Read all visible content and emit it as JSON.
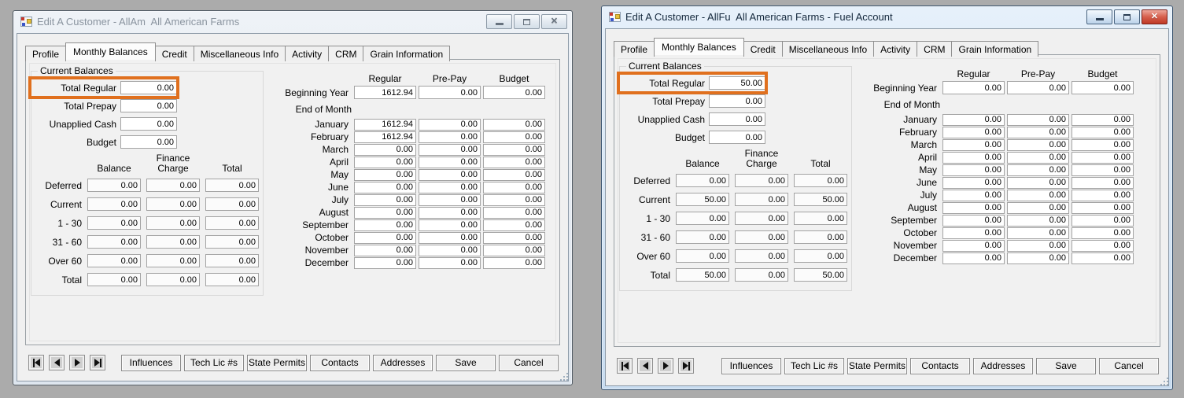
{
  "colors": {
    "highlight_border": "#e0701e",
    "active_titlebar": "#c8dcf0",
    "inactive_titlebar": "#dde5ee",
    "close_button_red": "#bf3a27",
    "desktop_background": "#ababab"
  },
  "app": {
    "tabs": [
      "Profile",
      "Monthly Balances",
      "Credit",
      "Miscellaneous Info",
      "Activity",
      "CRM",
      "Grain Information"
    ],
    "active_tab": "Monthly Balances",
    "nav_icons": [
      "nav-first",
      "nav-previous",
      "nav-next",
      "nav-last"
    ],
    "caption_icons": [
      "minimize",
      "maximize",
      "close"
    ],
    "footer_buttons": [
      "Influences",
      "Tech Lic #s",
      "State Permits",
      "Contacts",
      "Addresses",
      "Save",
      "Cancel"
    ]
  },
  "windows": [
    {
      "title": "Edit A Customer - AllAm  All American Farms",
      "state": "inactive",
      "highlighted_field": "Total Regular",
      "current_balances": {
        "title": "Current Balances",
        "rows": [
          {
            "label": "Total Regular",
            "value": "0.00",
            "highlighted": true
          },
          {
            "label": "Total Prepay",
            "value": "0.00"
          },
          {
            "label": "Unapplied Cash",
            "value": "0.00"
          },
          {
            "label": "Budget",
            "value": "0.00"
          }
        ]
      },
      "aging": {
        "columns": [
          "Balance",
          "Finance Charge",
          "Total"
        ],
        "rows": [
          {
            "label": "Deferred",
            "balance": "0.00",
            "finance_charge": "0.00",
            "total": "0.00"
          },
          {
            "label": "Current",
            "balance": "0.00",
            "finance_charge": "0.00",
            "total": "0.00"
          },
          {
            "label": "1 - 30",
            "balance": "0.00",
            "finance_charge": "0.00",
            "total": "0.00"
          },
          {
            "label": "31 - 60",
            "balance": "0.00",
            "finance_charge": "0.00",
            "total": "0.00"
          },
          {
            "label": "Over 60",
            "balance": "0.00",
            "finance_charge": "0.00",
            "total": "0.00"
          },
          {
            "label": "Total",
            "balance": "0.00",
            "finance_charge": "0.00",
            "total": "0.00"
          }
        ]
      },
      "monthly": {
        "columns": [
          "Regular",
          "Pre-Pay",
          "Budget"
        ],
        "beginning_year": {
          "label": "Beginning Year",
          "regular": "1612.94",
          "prepay": "0.00",
          "budget": "0.00"
        },
        "end_of_month_label": "End of Month",
        "months": [
          {
            "label": "January",
            "regular": "1612.94",
            "prepay": "0.00",
            "budget": "0.00"
          },
          {
            "label": "February",
            "regular": "1612.94",
            "prepay": "0.00",
            "budget": "0.00"
          },
          {
            "label": "March",
            "regular": "0.00",
            "prepay": "0.00",
            "budget": "0.00"
          },
          {
            "label": "April",
            "regular": "0.00",
            "prepay": "0.00",
            "budget": "0.00"
          },
          {
            "label": "May",
            "regular": "0.00",
            "prepay": "0.00",
            "budget": "0.00"
          },
          {
            "label": "June",
            "regular": "0.00",
            "prepay": "0.00",
            "budget": "0.00"
          },
          {
            "label": "July",
            "regular": "0.00",
            "prepay": "0.00",
            "budget": "0.00"
          },
          {
            "label": "August",
            "regular": "0.00",
            "prepay": "0.00",
            "budget": "0.00"
          },
          {
            "label": "September",
            "regular": "0.00",
            "prepay": "0.00",
            "budget": "0.00"
          },
          {
            "label": "October",
            "regular": "0.00",
            "prepay": "0.00",
            "budget": "0.00"
          },
          {
            "label": "November",
            "regular": "0.00",
            "prepay": "0.00",
            "budget": "0.00"
          },
          {
            "label": "December",
            "regular": "0.00",
            "prepay": "0.00",
            "budget": "0.00"
          }
        ]
      }
    },
    {
      "title": "Edit A Customer - AllFu  All American Farms - Fuel Account",
      "state": "active",
      "highlighted_field": "Total Regular",
      "current_balances": {
        "title": "Current Balances",
        "rows": [
          {
            "label": "Total Regular",
            "value": "50.00",
            "highlighted": true
          },
          {
            "label": "Total Prepay",
            "value": "0.00"
          },
          {
            "label": "Unapplied Cash",
            "value": "0.00"
          },
          {
            "label": "Budget",
            "value": "0.00"
          }
        ]
      },
      "aging": {
        "columns": [
          "Balance",
          "Finance Charge",
          "Total"
        ],
        "rows": [
          {
            "label": "Deferred",
            "balance": "0.00",
            "finance_charge": "0.00",
            "total": "0.00"
          },
          {
            "label": "Current",
            "balance": "50.00",
            "finance_charge": "0.00",
            "total": "50.00"
          },
          {
            "label": "1 - 30",
            "balance": "0.00",
            "finance_charge": "0.00",
            "total": "0.00"
          },
          {
            "label": "31 - 60",
            "balance": "0.00",
            "finance_charge": "0.00",
            "total": "0.00"
          },
          {
            "label": "Over 60",
            "balance": "0.00",
            "finance_charge": "0.00",
            "total": "0.00"
          },
          {
            "label": "Total",
            "balance": "50.00",
            "finance_charge": "0.00",
            "total": "50.00"
          }
        ]
      },
      "monthly": {
        "columns": [
          "Regular",
          "Pre-Pay",
          "Budget"
        ],
        "beginning_year": {
          "label": "Beginning Year",
          "regular": "0.00",
          "prepay": "0.00",
          "budget": "0.00"
        },
        "end_of_month_label": "End of Month",
        "months": [
          {
            "label": "January",
            "regular": "0.00",
            "prepay": "0.00",
            "budget": "0.00"
          },
          {
            "label": "February",
            "regular": "0.00",
            "prepay": "0.00",
            "budget": "0.00"
          },
          {
            "label": "March",
            "regular": "0.00",
            "prepay": "0.00",
            "budget": "0.00"
          },
          {
            "label": "April",
            "regular": "0.00",
            "prepay": "0.00",
            "budget": "0.00"
          },
          {
            "label": "May",
            "regular": "0.00",
            "prepay": "0.00",
            "budget": "0.00"
          },
          {
            "label": "June",
            "regular": "0.00",
            "prepay": "0.00",
            "budget": "0.00"
          },
          {
            "label": "July",
            "regular": "0.00",
            "prepay": "0.00",
            "budget": "0.00"
          },
          {
            "label": "August",
            "regular": "0.00",
            "prepay": "0.00",
            "budget": "0.00"
          },
          {
            "label": "September",
            "regular": "0.00",
            "prepay": "0.00",
            "budget": "0.00"
          },
          {
            "label": "October",
            "regular": "0.00",
            "prepay": "0.00",
            "budget": "0.00"
          },
          {
            "label": "November",
            "regular": "0.00",
            "prepay": "0.00",
            "budget": "0.00"
          },
          {
            "label": "December",
            "regular": "0.00",
            "prepay": "0.00",
            "budget": "0.00"
          }
        ]
      }
    }
  ]
}
